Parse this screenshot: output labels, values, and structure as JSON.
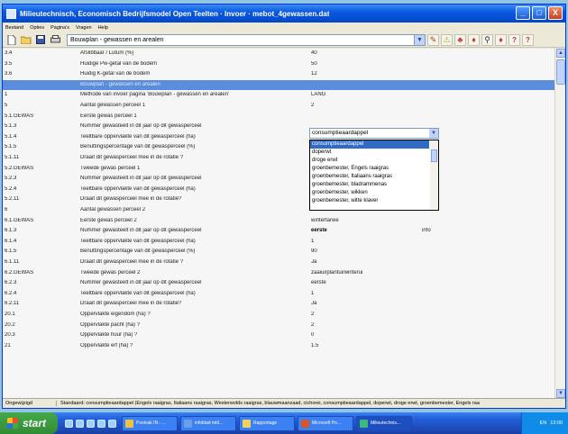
{
  "window": {
    "title": "Milieutechnisch, Economisch Bedrijfsmodel Open Teelten · Invoer · mebot_4gewassen.dat",
    "min": "_",
    "max": "□",
    "close": "X"
  },
  "menu": [
    "Bestand",
    "Opties",
    "Pagina's",
    "Vragen",
    "Help"
  ],
  "toolbar": {
    "page_select": "Bouwplan - gewassen en arealen",
    "help_labels": [
      "?",
      "?"
    ]
  },
  "rows": [
    {
      "code": "3.4",
      "question": "Afslibbaar / Lutum (%)",
      "value": "40"
    },
    {
      "code": "3.5",
      "question": "Huidige Pw-getal van de bodem",
      "value": "50"
    },
    {
      "code": "3.6",
      "question": "Huidig K-getal van de bodem",
      "value": "12"
    },
    {
      "code": "",
      "question": "Bouwplan - gewassen en arealen",
      "value": "",
      "section": true
    },
    {
      "code": "1",
      "question": "Methode van invoer pagina 'Bouwplan - gewassen en arealen'",
      "value": "LANG"
    },
    {
      "code": "5",
      "question": "Aantal gewassen perceel 1",
      "value": "2"
    },
    {
      "code": "5.1.GEWAS",
      "question": "Eerste gewas perceel 1",
      "value": ""
    },
    {
      "code": "5.1.3",
      "question": "Nummer gewasteelt in dit jaar op dit gewasperceel",
      "value": ""
    },
    {
      "code": "5.1.4",
      "question": "Teeltbare oppervlakte van dit gewasperceel (ha)",
      "value": ""
    },
    {
      "code": "5.1.5",
      "question": "Benuttingspercentage van dit gewasperceel (%)",
      "value": ""
    },
    {
      "code": "5.1.11",
      "question": "Draait dit gewasperceel mee in de rotatie ?",
      "value": ""
    },
    {
      "code": "5.2.GEWAS",
      "question": "Tweede gewas perceel 1",
      "value": ""
    },
    {
      "code": "5.2.3",
      "question": "Nummer gewasteelt in dit jaar op dit gewasperceel",
      "value": ""
    },
    {
      "code": "5.2.4",
      "question": "Teeltbare oppervlakte van dit gewasperceel (ha)",
      "value": "1"
    },
    {
      "code": "5.2.11",
      "question": "Draait dit gewasperceel mee in de rotatie?",
      "value": "Ja"
    },
    {
      "code": "6",
      "question": "Aantal gewassen perceel 2",
      "value": "2"
    },
    {
      "code": "6.1.GEWAS",
      "question": "Eerste gewas perceel 2",
      "value": "wintertarwe"
    },
    {
      "code": "6.1.3",
      "question": "Nummer gewasteelt in dit jaar op dit gewasperceel",
      "value": "eerste",
      "bold": true,
      "extra": "info"
    },
    {
      "code": "6.1.4",
      "question": "Teeltbare oppervlakte van dit gewasperceel (ha)",
      "value": "1"
    },
    {
      "code": "6.1.5",
      "question": "Benuttingspercentage van dit gewasperceel (%)",
      "value": "90"
    },
    {
      "code": "6.1.11",
      "question": "Draait dit gewasperceel mee in de rotatie ?",
      "value": "Ja"
    },
    {
      "code": "6.2.GEWAS",
      "question": "Tweede gewas perceel 2",
      "value": "zaaiui/plantui/winterui"
    },
    {
      "code": "6.2.3",
      "question": "Nummer gewasteelt in dit jaar op dit gewasperceel",
      "value": "eerste"
    },
    {
      "code": "6.2.4",
      "question": "Teeltbare oppervlakte van dit gewasperceel (ha)",
      "value": "1"
    },
    {
      "code": "6.2.11",
      "question": "Draait dit gewasperceel mee in de rotatie?",
      "value": "Ja"
    },
    {
      "code": "20.1",
      "question": "Oppervlakte eigendom (ha) ?",
      "value": "2"
    },
    {
      "code": "20.2",
      "question": "Oppervlakte pacht (ha) ?",
      "value": "2"
    },
    {
      "code": "20.3",
      "question": "Oppervlakte huur (ha) ?",
      "value": "0"
    },
    {
      "code": "21",
      "question": "Oppervlakte erf (ha) ?",
      "value": "1.5"
    }
  ],
  "dropdown": {
    "selected": "consumptieaardappel",
    "options": [
      "consumptieaardappel",
      "doperwt",
      "droge erwt",
      "groenbemester, Engels raaigras",
      "groenbemester, Italiaans raaigras",
      "groenbemester, bladrammenas",
      "groenbemester, wikken",
      "groenbemester, witte klaver"
    ]
  },
  "status": {
    "left": "Ongewijzigd",
    "right": "Standaard: consumptieaardappel (Engels raaigras, Italiaans raaigras, Westerwolds raaigras, blauwmaanzaad, cichorei, consumptieaardappel, doperwt, droge erwt, groenbemester, Engels raa"
  },
  "taskbar": {
    "start": "start",
    "tasks": [
      "Postvak IN - ...",
      "infoblad mbl...",
      "Rapportage",
      "Microsoft Po...",
      "Milieutechnis..."
    ],
    "tray_lang": "EN",
    "tray_time": "13:00"
  },
  "colors": {
    "section_row": "#5a8ddc",
    "selection": "#316ac5",
    "titlebar": "#0a5ae0",
    "desktop": "#8fc6e3"
  }
}
